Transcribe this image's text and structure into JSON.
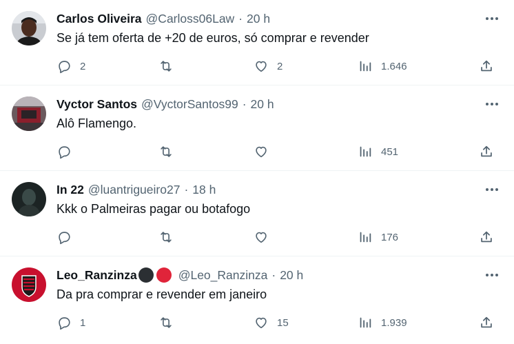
{
  "tweets": [
    {
      "name": "Carlos Oliveira",
      "handle": "@Carloss06Law",
      "sep": "·",
      "time": "20 h",
      "text": "Se já tem oferta de +20 de euros, só comprar e revender",
      "replies": "2",
      "retweets": "",
      "likes": "2",
      "views": "1.646"
    },
    {
      "name": "Vyctor Santos",
      "handle": "@VyctorSantos99",
      "sep": "·",
      "time": "20 h",
      "text": "Alô Flamengo.",
      "replies": "",
      "retweets": "",
      "likes": "",
      "views": "451"
    },
    {
      "name": "In 22",
      "handle": "@luantrigueiro27",
      "sep": "·",
      "time": "18 h",
      "text": "Kkk o Palmeiras pagar ou botafogo",
      "replies": "",
      "retweets": "",
      "likes": "",
      "views": "176"
    },
    {
      "name": "Leo_Ranzinza",
      "handle": "@Leo_Ranzinza",
      "sep": "·",
      "time": "20 h",
      "text": "Da pra comprar e revender em janeiro",
      "replies": "1",
      "retweets": "",
      "likes": "15",
      "views": "1.939"
    }
  ],
  "colors": {
    "text_primary": "#0f1419",
    "text_secondary": "#536471",
    "divider": "#eff3f4",
    "badge_black": "#2b2f33",
    "badge_red": "#e0243a"
  },
  "icons": {
    "more": "more-horizontal-icon",
    "reply": "reply-bubble-icon",
    "retweet": "retweet-icon",
    "like": "heart-icon",
    "views": "bar-chart-icon",
    "share": "share-upload-icon"
  }
}
